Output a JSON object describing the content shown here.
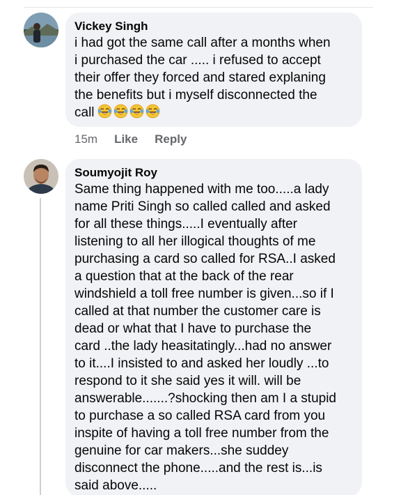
{
  "comments": [
    {
      "author": "Vickey Singh",
      "text": "i had got the same call after a months when\ni purchased  the car ..... i refused to accept\ntheir offer they forced and stared explaning\nthe benefits  but i myself disconnected the\ncall",
      "emojis": [
        "tears-of-joy-icon",
        "tears-of-joy-icon",
        "tears-of-joy-icon",
        "tears-of-joy-icon"
      ],
      "time": "15m",
      "like_label": "Like",
      "reply_label": "Reply"
    },
    {
      "author": "Soumyojit Roy",
      "text": "Same thing happened with me too.....a lady\nname Priti Singh so called called and asked\nfor all these things.....I eventually after\nlistening to all her illogical thoughts of me\npurchasing a card so called for RSA..I asked\na question that at  the back of the rear\nwindshield a toll free number  is given...so if I\ncalled at that number the customer care is\ndead or what that I have to purchase the\ncard ..the lady heasitatingly...had no answer\nto it....I insisted to and asked her loudly ...to\nrespond to it she said yes it will. will be\nanswerable.......?shocking then am I a stupid\nto purchase a so called RSA card from you\ninspite of having a toll free number from the\ngenuine for car makers...she suddey\ndisconnect the phone.....and the rest is...is\nsaid above....."
    }
  ],
  "colors": {
    "bubble": "#f0f2f5",
    "meta_text": "#65676b",
    "thread_line": "#ccd0d5"
  }
}
